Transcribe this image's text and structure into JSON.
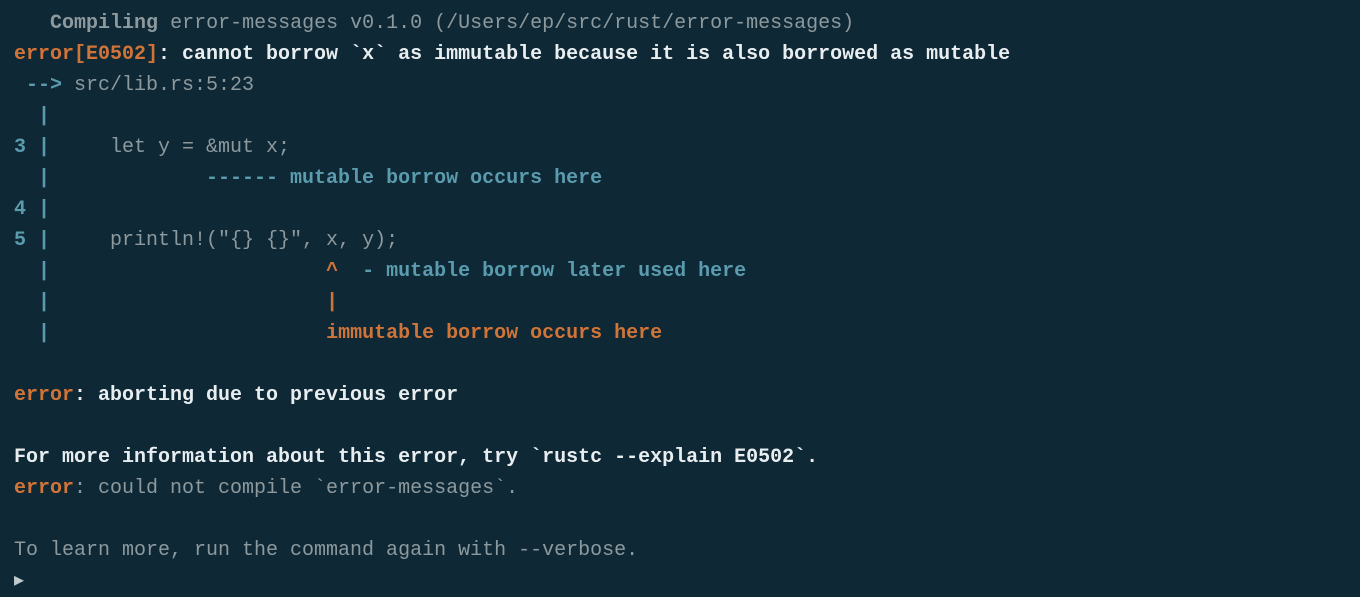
{
  "compile": {
    "label": "Compiling",
    "package": "error-messages v0.1.0 (/Users/ep/src/rust/error-messages)"
  },
  "error_header": {
    "error_code": "error[E0502]",
    "message": ": cannot borrow `x` as immutable because it is also borrowed as mutable"
  },
  "location": {
    "arrow": " -->",
    "file": " src/lib.rs:5:23"
  },
  "snippet": {
    "pipe_only": "  |",
    "line3_num": "3 |",
    "line3_code": "     let y = &mut x;",
    "line3_underline": "  |             ------",
    "line3_msg": " mutable borrow occurs here",
    "line4_num": "4 |",
    "line5_num": "5 |",
    "line5_code": "     println!(\"{} {}\", x, y);",
    "caret_line_prefix": "  |                       ",
    "caret": "^",
    "dash_msg": "  - mutable borrow later used here",
    "pipe_underline_prefix": "  |                       ",
    "pipe_underline": "|",
    "immutable_prefix": "  |                       ",
    "immutable_msg": "immutable borrow occurs here"
  },
  "abort": {
    "error_label": "error",
    "msg": ": aborting due to previous error"
  },
  "info": {
    "more_info": "For more information about this error, try `rustc --explain E0502`."
  },
  "compile_fail": {
    "error_label": "error",
    "msg": ": could not compile `error-messages`."
  },
  "learn_more": "To learn more, run the command again with --verbose.",
  "cursor": "▸"
}
